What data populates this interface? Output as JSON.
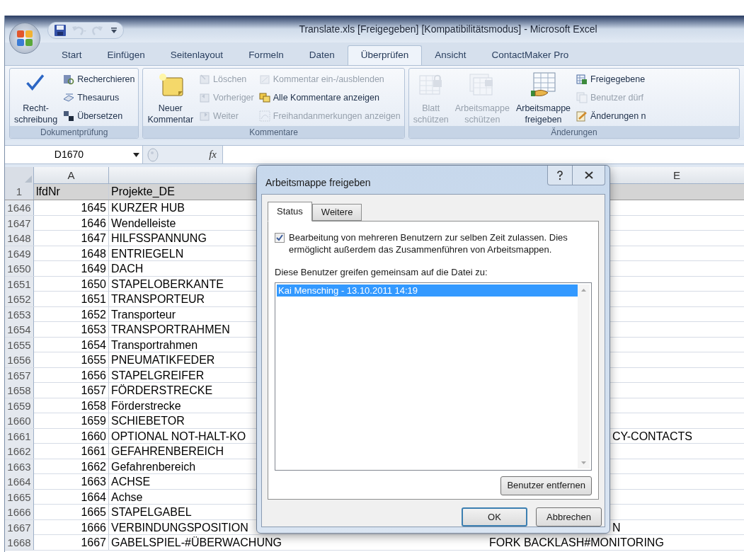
{
  "window": {
    "title": "Translate.xls [Freigegeben] [Kompatibilitätsmodus] - Microsoft Excel"
  },
  "quick_access": [
    {
      "kind": "save",
      "disabled": false
    },
    {
      "kind": "undo",
      "disabled": true
    },
    {
      "kind": "redo",
      "disabled": true
    },
    {
      "kind": "customize",
      "disabled": false
    }
  ],
  "ribbon_tabs": [
    {
      "label": "Start",
      "selected": false
    },
    {
      "label": "Einfügen",
      "selected": false
    },
    {
      "label": "Seitenlayout",
      "selected": false
    },
    {
      "label": "Formeln",
      "selected": false
    },
    {
      "label": "Daten",
      "selected": false
    },
    {
      "label": "Überprüfen",
      "selected": true
    },
    {
      "label": "Ansicht",
      "selected": false
    },
    {
      "label": "ContactMaker Pro",
      "selected": false
    }
  ],
  "ribbon_groups": [
    {
      "label": "Dokumentprüfung",
      "columns": [
        {
          "kind": "large",
          "lines": [
            "Recht-",
            "schreibung"
          ],
          "disabled": false
        },
        {
          "kind": "stack",
          "items": [
            {
              "label": "Recherchieren",
              "disabled": false
            },
            {
              "label": "Thesaurus",
              "disabled": false
            },
            {
              "label": "Übersetzen",
              "disabled": false
            }
          ]
        }
      ]
    },
    {
      "label": "Kommentare",
      "columns": [
        {
          "kind": "large",
          "lines": [
            "Neuer",
            "Kommentar"
          ],
          "disabled": false
        },
        {
          "kind": "stack",
          "items": [
            {
              "label": "Löschen",
              "disabled": true
            },
            {
              "label": "Vorheriger",
              "disabled": true
            },
            {
              "label": "Weiter",
              "disabled": true
            }
          ]
        },
        {
          "kind": "stack",
          "items": [
            {
              "label": "Kommentar ein-/ausblenden",
              "disabled": true
            },
            {
              "label": "Alle Kommentare anzeigen",
              "disabled": false
            },
            {
              "label": "Freihandanmerkungen anzeigen",
              "disabled": true
            }
          ]
        }
      ]
    },
    {
      "label": "Änderungen",
      "columns": [
        {
          "kind": "large",
          "lines": [
            "Blatt",
            "schützen"
          ],
          "disabled": true
        },
        {
          "kind": "large",
          "lines": [
            "Arbeitsmappe",
            "schützen"
          ],
          "disabled": true
        },
        {
          "kind": "large",
          "lines": [
            "Arbeitsmappe",
            "freigeben"
          ],
          "disabled": false
        },
        {
          "kind": "stack",
          "items": [
            {
              "label": "Freigegebene",
              "disabled": false
            },
            {
              "label": "Benutzer dürf",
              "disabled": true
            },
            {
              "label": "Änderungen n",
              "disabled": false
            }
          ]
        }
      ]
    }
  ],
  "formula_bar": {
    "name_box": "D1670",
    "function_label": "fx"
  },
  "sheet": {
    "column_headers": {
      "column_a": "A",
      "column_e": "E"
    },
    "header_row": {
      "row": "1",
      "lfdnr": "lfdNr",
      "projekte_de": "Projekte_DE"
    },
    "rows": [
      {
        "row": "1646",
        "lfdnr": "1645",
        "projekte_de": "KURZER HUB"
      },
      {
        "row": "1647",
        "lfdnr": "1646",
        "projekte_de": "Wendelleiste"
      },
      {
        "row": "1648",
        "lfdnr": "1647",
        "projekte_de": "HILFSSPANNUNG"
      },
      {
        "row": "1649",
        "lfdnr": "1648",
        "projekte_de": "ENTRIEGELN"
      },
      {
        "row": "1650",
        "lfdnr": "1649",
        "projekte_de": "DACH"
      },
      {
        "row": "1651",
        "lfdnr": "1650",
        "projekte_de": "STAPELOBERKANTE"
      },
      {
        "row": "1652",
        "lfdnr": "1651",
        "projekte_de": "TRANSPORTEUR"
      },
      {
        "row": "1653",
        "lfdnr": "1652",
        "projekte_de": "Transporteur"
      },
      {
        "row": "1654",
        "lfdnr": "1653",
        "projekte_de": "TRANSPORTRAHMEN"
      },
      {
        "row": "1655",
        "lfdnr": "1654",
        "projekte_de": "Transportrahmen"
      },
      {
        "row": "1656",
        "lfdnr": "1655",
        "projekte_de": "PNEUMATIKFEDER"
      },
      {
        "row": "1657",
        "lfdnr": "1656",
        "projekte_de": "STAPELGREIFER"
      },
      {
        "row": "1658",
        "lfdnr": "1657",
        "projekte_de": "FÖRDERSTRECKE"
      },
      {
        "row": "1659",
        "lfdnr": "1658",
        "projekte_de": "Förderstrecke"
      },
      {
        "row": "1660",
        "lfdnr": "1659",
        "projekte_de": "SCHIEBETOR"
      },
      {
        "row": "1661",
        "lfdnr": "1660",
        "projekte_de": "OPTIONAL NOT-HALT-KO",
        "column_e": "CY-CONTACTS"
      },
      {
        "row": "1662",
        "lfdnr": "1661",
        "projekte_de": "GEFAHRENBEREICH"
      },
      {
        "row": "1663",
        "lfdnr": "1662",
        "projekte_de": "Gefahrenbereich"
      },
      {
        "row": "1664",
        "lfdnr": "1663",
        "projekte_de": "ACHSE"
      },
      {
        "row": "1665",
        "lfdnr": "1664",
        "projekte_de": "Achse"
      },
      {
        "row": "1666",
        "lfdnr": "1665",
        "projekte_de": "STAPELGABEL"
      },
      {
        "row": "1667",
        "lfdnr": "1666",
        "projekte_de": "VERBINDUNGSPOSITION",
        "column_e": "N"
      },
      {
        "row": "1668",
        "lfdnr": "1667",
        "projekte_de": "GABELSPIEL-#ÜBERWACHUNG",
        "column_d": "FORK BACKLASH#MONITORING"
      }
    ]
  },
  "dialog": {
    "title": "Arbeitsmappe freigeben",
    "tabs": [
      {
        "label": "Status",
        "selected": true
      },
      {
        "label": "Weitere",
        "selected": false
      }
    ],
    "allow_multi_user": {
      "checked": true,
      "label": "Bearbeitung von mehreren Benutzern zur selben Zeit zulassen. Dies ermöglicht außerdem das Zusammenführen von Arbeitsmappen."
    },
    "users_label": "Diese Benutzer greifen gemeinsam auf die Datei zu:",
    "users": [
      {
        "label": "Kai Mensching - 13.10.2011 14:19",
        "selected": true
      }
    ],
    "remove_button": "Benutzer entfernen",
    "buttons": [
      {
        "label": "OK",
        "default": true
      },
      {
        "label": "Abbrechen",
        "default": false
      }
    ]
  }
}
